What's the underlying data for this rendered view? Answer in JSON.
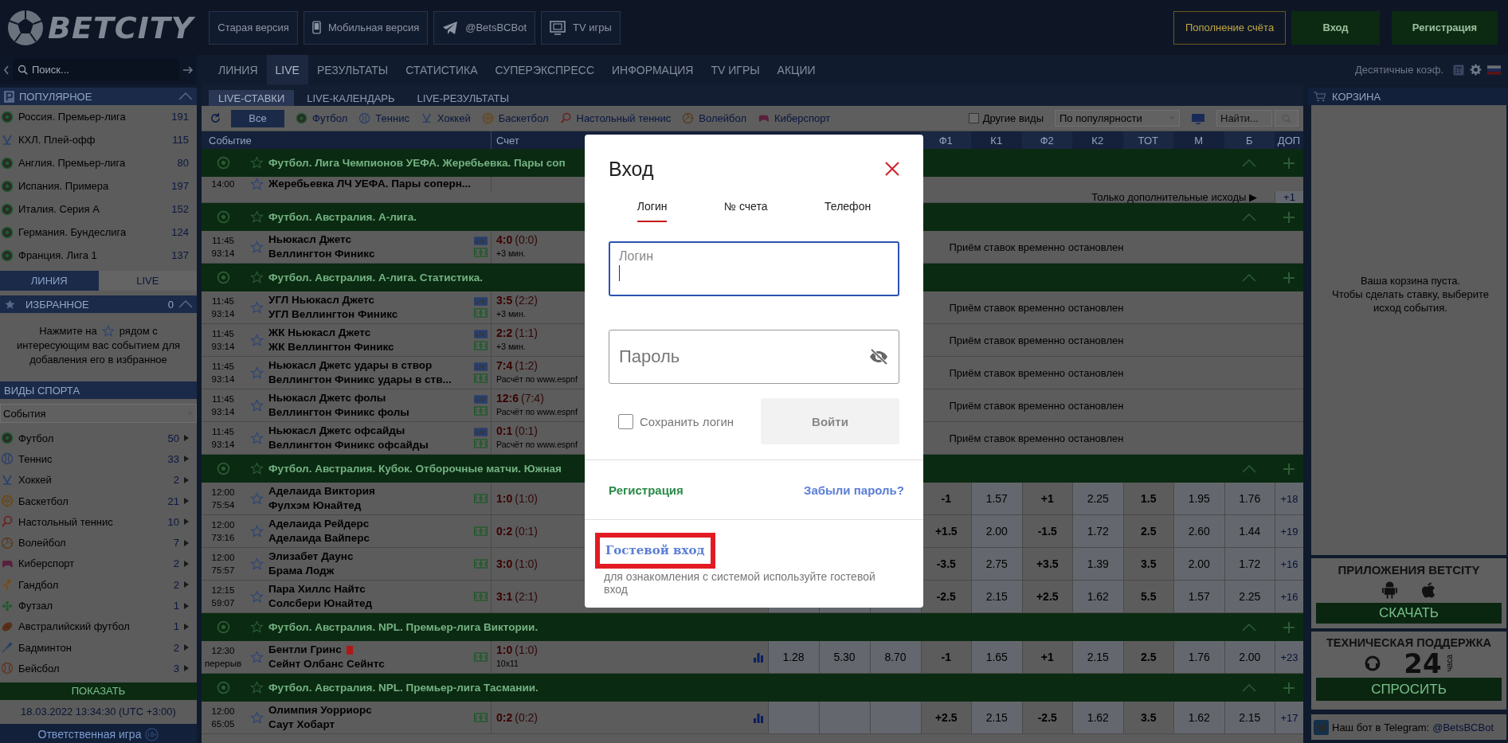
{
  "header": {
    "logo": "BETCITY",
    "links": [
      {
        "label": "Старая версия",
        "kind": "plain"
      },
      {
        "label": "Мобильная версия",
        "kind": "phone"
      },
      {
        "label": "@BetsBCBot",
        "kind": "telegram"
      },
      {
        "label": "TV игры",
        "kind": "tv"
      }
    ],
    "buttons": [
      {
        "label": "Пополнение счёта",
        "kind": "deposit"
      },
      {
        "label": "Вход",
        "kind": "login"
      },
      {
        "label": "Регистрация",
        "kind": "register"
      }
    ]
  },
  "nav": {
    "search": {
      "placeholder": "Поиск..."
    },
    "items": [
      {
        "label": "ЛИНИЯ",
        "selected": false
      },
      {
        "label": "LIVE",
        "selected": true
      },
      {
        "label": "РЕЗУЛЬТАТЫ",
        "selected": false
      },
      {
        "label": "СТАТИСТИКА",
        "selected": false
      },
      {
        "label": "СУПЕРЭКСПРЕСС",
        "selected": false
      },
      {
        "label": "ИНФОРМАЦИЯ",
        "selected": false
      },
      {
        "label": "TV ИГРЫ",
        "selected": false
      },
      {
        "label": "АКЦИИ",
        "selected": false
      }
    ],
    "odds_format": "Десятичные коэф."
  },
  "sidebar": {
    "popular": {
      "title": "ПОПУЛЯРНОЕ",
      "items": [
        {
          "kind": "football",
          "name": "Россия. Премьер-лига",
          "count": "191"
        },
        {
          "kind": "hockey",
          "name": "КХЛ. Плей-офф",
          "count": "115"
        },
        {
          "kind": "football",
          "name": "Англия. Премьер-лига",
          "count": "80"
        },
        {
          "kind": "football",
          "name": "Испания. Примера",
          "count": "197"
        },
        {
          "kind": "football",
          "name": "Италия. Серия A",
          "count": "152"
        },
        {
          "kind": "football",
          "name": "Германия. Бундеслига",
          "count": "124"
        },
        {
          "kind": "football",
          "name": "Франция. Лига 1",
          "count": "137"
        }
      ]
    },
    "tabs": [
      {
        "label": "ЛИНИЯ",
        "selected": false
      },
      {
        "label": "LIVE",
        "selected": true
      }
    ],
    "favorites": {
      "title": "ИЗБРАННОЕ",
      "count": "0",
      "hint": [
        "Нажмите на",
        "рядом с",
        "интересующим вас событием для добавления его в избранное"
      ]
    },
    "sports": {
      "title": "ВИДЫ СПОРТА",
      "filter": "События",
      "items": [
        {
          "kind": "football",
          "name": "Футбол",
          "count": "50"
        },
        {
          "kind": "tennis",
          "name": "Теннис",
          "count": "33"
        },
        {
          "kind": "hockey",
          "name": "Хоккей",
          "count": "2"
        },
        {
          "kind": "basketball",
          "name": "Баскетбол",
          "count": "21"
        },
        {
          "kind": "table_tennis",
          "name": "Настольный теннис",
          "count": "10"
        },
        {
          "kind": "volleyball",
          "name": "Волейбол",
          "count": "7"
        },
        {
          "kind": "esports",
          "name": "Киберспорт",
          "count": "2"
        },
        {
          "kind": "handball",
          "name": "Гандбол",
          "count": "2"
        },
        {
          "kind": "futsal",
          "name": "Футзал",
          "count": "1"
        },
        {
          "kind": "aussie_rules",
          "name": "Австралийский футбол",
          "count": "1"
        },
        {
          "kind": "badminton",
          "name": "Бадминтон",
          "count": "2"
        },
        {
          "kind": "baseball",
          "name": "Бейсбол",
          "count": "3"
        }
      ],
      "button": "ПОКАЗАТЬ"
    },
    "clock": "18.03.2022 13:34:30 (UTC +3:00)",
    "responsible": "Ответственная игра"
  },
  "live": {
    "tabs": [
      {
        "label": "LIVE-СТАВКИ",
        "selected": true
      },
      {
        "label": "LIVE-КАЛЕНДАРЬ",
        "selected": false
      },
      {
        "label": "LIVE-РЕЗУЛЬТАТЫ",
        "selected": false
      }
    ],
    "filters": [
      {
        "kind": "all",
        "label": "Все",
        "selected": true
      },
      {
        "kind": "football",
        "label": "Футбол",
        "selected": false
      },
      {
        "kind": "tennis",
        "label": "Теннис",
        "selected": false
      },
      {
        "kind": "hockey",
        "label": "Хоккей",
        "selected": false
      },
      {
        "kind": "basketball",
        "label": "Баскетбол",
        "selected": false
      },
      {
        "kind": "table_tennis",
        "label": "Настольный теннис",
        "selected": false
      },
      {
        "kind": "volleyball",
        "label": "Волейбол",
        "selected": false
      },
      {
        "kind": "esports",
        "label": "Киберспорт",
        "selected": false
      }
    ],
    "other_sports": {
      "label": "Другие виды",
      "checked": false
    },
    "sort": "По популярности",
    "search": {
      "placeholder": "Найти..."
    },
    "table": {
      "columns": [
        "Событие",
        "Счет",
        "Ф1",
        "К1",
        "Ф2",
        "К2",
        "ТОТ",
        "М",
        "Б",
        "ДОП"
      ],
      "groups": [
        {
          "title": "Футбол. Лига Чемпионов УЕФА. Жеребьевка. Пары соп",
          "rows": [
            {
              "time": "14:00",
              "teams": [
                "Жеребьевка ЛЧ УЕФА. Пары соперн..."
              ],
              "red_card": false,
              "live": false,
              "field": false,
              "stats": false,
              "only_extra": "Только дополнительные исходы ▶",
              "extra": "+1"
            }
          ]
        },
        {
          "title": "Футбол. Австралия. А-лига.",
          "rows": [
            {
              "time": "11:45",
              "clock": "93:14",
              "teams": [
                "Ньюкасл Джетс",
                "Веллингтон Финикс"
              ],
              "red_card": false,
              "live": true,
              "field": true,
              "score": "4:0",
              "period": "(0:0)",
              "note": "+3 мин.",
              "stats": false,
              "suspended": "Приём ставок временно остановлен"
            }
          ]
        },
        {
          "title": "Футбол. Австралия. А-лига. Статистика.",
          "rows": [
            {
              "time": "11:45",
              "clock": "93:14",
              "teams": [
                "УГЛ Ньюкасл Джетс",
                "УГЛ Веллингтон Финикс"
              ],
              "red_card": false,
              "live": true,
              "field": true,
              "score": "3:5",
              "period": "(2:2)",
              "note": "+3 мин.",
              "stats": false,
              "suspended": "Приём ставок временно остановлен"
            },
            {
              "time": "11:45",
              "clock": "93:14",
              "teams": [
                "ЖК Ньюкасл Джетс",
                "ЖК Веллингтон Финикс"
              ],
              "red_card": false,
              "live": true,
              "field": true,
              "score": "2:2",
              "period": "(1:1)",
              "note": "+3 мин.",
              "stats": false,
              "suspended": "Приём ставок временно остановлен"
            },
            {
              "time": "11:45",
              "clock": "93:14",
              "teams": [
                "Ньюкасл Джетс удары в створ",
                "Веллингтон Финикс удары в ств..."
              ],
              "red_card": false,
              "live": true,
              "field": true,
              "score": "7:4",
              "period": "(1:2)",
              "note": "Расчёт по www.espnf",
              "stats": false,
              "suspended": "Приём ставок временно остановлен"
            },
            {
              "time": "11:45",
              "clock": "93:14",
              "teams": [
                "Ньюкасл Джетс фолы",
                "Веллингтон Финикс фолы"
              ],
              "red_card": false,
              "live": true,
              "field": true,
              "score": "12:6",
              "period": "(7:4)",
              "note": "Расчёт по www.espnf",
              "stats": false,
              "suspended": "Приём ставок временно остановлен"
            },
            {
              "time": "11:45",
              "clock": "93:14",
              "teams": [
                "Ньюкасл Джетс офсайды",
                "Веллингтон Финикс офсайды"
              ],
              "red_card": false,
              "live": true,
              "field": true,
              "score": "0:1",
              "period": "(0:1)",
              "note": "Расчёт по www.espnf",
              "stats": false,
              "suspended": "Приём ставок временно остановлен"
            }
          ]
        },
        {
          "title": "Футбол. Австралия. Кубок. Отборочные матчи. Южная",
          "rows": [
            {
              "time": "12:00",
              "clock": "75:54",
              "teams": [
                "Аделаида Виктория",
                "Фулхэм Юнайтед"
              ],
              "red_card": false,
              "live": false,
              "field": true,
              "score": "1:0",
              "period": "(1:0)",
              "stats": false,
              "odds": [
                "-1",
                "1.57",
                "+1",
                "2.25",
                "1.5",
                "1.95",
                "1.76"
              ],
              "extra": "+18"
            },
            {
              "time": "12:00",
              "clock": "73:16",
              "teams": [
                "Аделаида Рейдерс",
                "Аделаида Вайперс"
              ],
              "red_card": false,
              "live": false,
              "field": true,
              "score": "0:2",
              "period": "(0:1)",
              "stats": false,
              "odds": [
                "+1.5",
                "2.00",
                "-1.5",
                "1.72",
                "2.5",
                "2.60",
                "1.44"
              ],
              "extra": "+19"
            },
            {
              "time": "12:00",
              "clock": "75:57",
              "teams": [
                "Элизабет Даунс",
                "Брама Лодж"
              ],
              "red_card": false,
              "live": false,
              "field": true,
              "score": "3:0",
              "period": "(1:0)",
              "stats": false,
              "odds": [
                "-3.5",
                "2.75",
                "+3.5",
                "1.39",
                "3.5",
                "2.00",
                "1.72"
              ],
              "extra": "+16"
            },
            {
              "time": "12:15",
              "clock": "59:07",
              "teams": [
                "Пара Хиллс Найтс",
                "Солсбери Юнайтед"
              ],
              "red_card": false,
              "live": false,
              "field": true,
              "score": "3:1",
              "period": "(2:1)",
              "stats": false,
              "odds": [
                "-2.5",
                "2.15",
                "+2.5",
                "1.62",
                "5.5",
                "1.57",
                "2.25"
              ],
              "extra": "+16"
            }
          ]
        },
        {
          "title": "Футбол. Австралия. NPL. Премьер-лига Виктории.",
          "rows": [
            {
              "time": "12:30",
              "clock": "перерыв",
              "teams": [
                "Бентли Гринс",
                "Сейнт Олбанс Сейнтс"
              ],
              "red_card": true,
              "live": false,
              "field": true,
              "score": "1:0",
              "period": "(1:0)",
              "note": "10x11",
              "stats": true,
              "main": [
                "1.28",
                "5.30",
                "8.70"
              ],
              "odds": [
                "-1",
                "1.65",
                "+1",
                "2.15",
                "2.5",
                "1.76",
                "2.00"
              ],
              "extra": "+23"
            }
          ]
        },
        {
          "title": "Футбол. Австралия. NPL. Премьер-лига Тасмании.",
          "rows": [
            {
              "time": "12:00",
              "clock": "65:05",
              "teams": [
                "Олимпия Уорриорс",
                "Саут Хобарт"
              ],
              "red_card": false,
              "live": false,
              "field": true,
              "score": "0:2",
              "period": "(0:2)",
              "stats": true,
              "odds": [
                "+2.5",
                "2.15",
                "-2.5",
                "1.62",
                "3.5",
                "1.62",
                "2.15"
              ],
              "extra": "+17"
            }
          ]
        }
      ]
    }
  },
  "cart": {
    "title": "КОРЗИНА",
    "message": [
      "Ваша корзина пуста.",
      "Чтобы сделать ставку, выберите исход события."
    ]
  },
  "apps": {
    "title": "ПРИЛОЖЕНИЯ BETCITY",
    "button": "СКАЧАТЬ"
  },
  "support": {
    "title": "ТЕХНИЧЕСКАЯ ПОДДЕРЖКА",
    "hours": "24",
    "unit": "часа",
    "button": "СПРОСИТЬ"
  },
  "telegram": {
    "text": "Наш бот в Telegram:",
    "link": "@BetsBCBot"
  },
  "modal": {
    "title": "Вход",
    "tabs": [
      {
        "label": "Логин",
        "selected": true
      },
      {
        "label": "№ счета",
        "selected": false
      },
      {
        "label": "Телефон",
        "selected": false
      }
    ],
    "login": {
      "label": "Логин",
      "focused": true
    },
    "password": {
      "placeholder": "Пароль"
    },
    "remember": {
      "label": "Сохранить логин",
      "checked": false
    },
    "submit": {
      "label": "Войти",
      "disabled": true
    },
    "register": "Регистрация",
    "forgot": "Забыли пароль?",
    "guest": {
      "label": "Гостевой вход",
      "highlighted": true
    },
    "guest_hint": "для ознакомления с системой используйте гостевой вход"
  }
}
